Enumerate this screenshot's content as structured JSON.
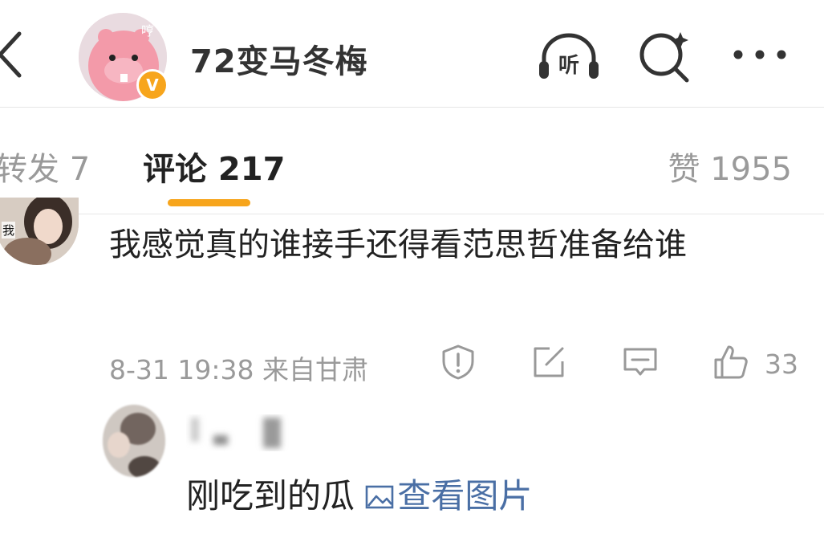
{
  "header": {
    "title": "72变马冬梅",
    "avatar_overlay_text": "哼",
    "badge": "V"
  },
  "tabs": [
    {
      "label": "转发 7"
    },
    {
      "label": "评论 217"
    },
    {
      "label": "赞 1955"
    }
  ],
  "comment": {
    "avatar_tag": "我",
    "text": "我感觉真的谁接手还得看范思哲准备给谁",
    "meta": "8-31 19:38  来自甘肃",
    "like_count": "33"
  },
  "reply": {
    "text": "刚吃到的瓜",
    "link": "查看图片"
  },
  "icons": {
    "listen_label": "听"
  },
  "colors": {
    "accent": "#f7a51c",
    "link": "#4a6fa5",
    "muted": "#9a9a9a"
  }
}
